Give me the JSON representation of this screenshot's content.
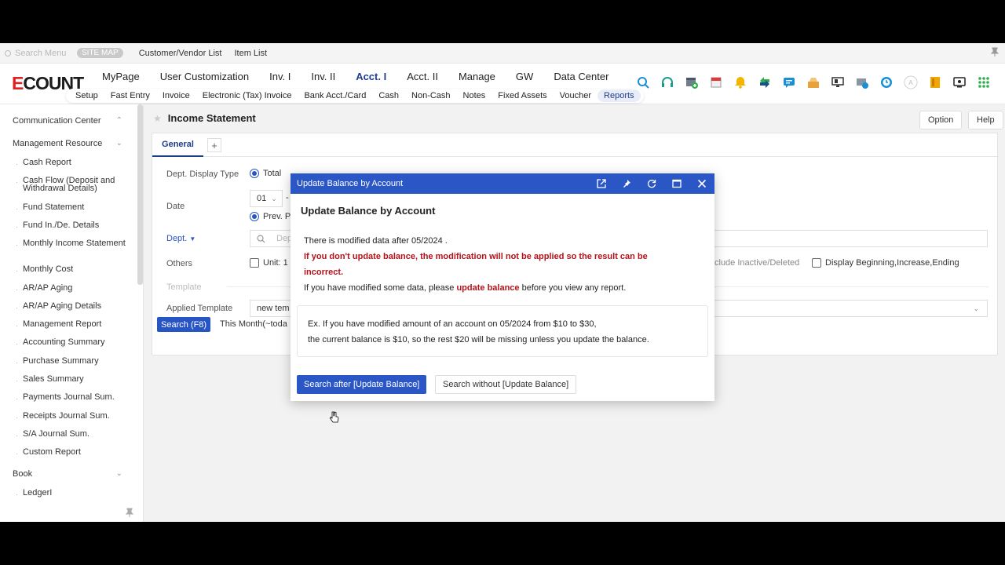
{
  "topbar": {
    "search_placeholder": "Search Menu",
    "sitemap_label": "SITE MAP",
    "links": [
      "Customer/Vendor List",
      "Item List"
    ]
  },
  "header": {
    "logo_text": "ECOUNT",
    "main_nav": [
      "MyPage",
      "User Customization",
      "Inv. I",
      "Inv. II",
      "Acct. I",
      "Acct. II",
      "Manage",
      "GW",
      "Data Center"
    ],
    "main_nav_active": "Acct. I",
    "sub_nav": [
      "Setup",
      "Fast Entry",
      "Invoice",
      "Electronic (Tax) Invoice",
      "Bank Acct./Card",
      "Cash",
      "Non-Cash",
      "Notes",
      "Fixed Assets",
      "Voucher",
      "Reports"
    ],
    "sub_nav_active": "Reports",
    "icons": [
      "search-icon",
      "headset-icon",
      "add-window-icon",
      "calendar-icon",
      "bell-icon",
      "sync-arrows-icon",
      "chat-icon",
      "inbox-icon",
      "display-icon",
      "print-settings-icon",
      "clock-icon",
      "user-avatar-icon",
      "book-icon",
      "monitor-icon",
      "grid-apps-icon"
    ]
  },
  "sidebar": {
    "sections": [
      {
        "label": "Communication Center",
        "chevron": "up"
      },
      {
        "label": "Management Resource",
        "chevron": "down"
      }
    ],
    "items": [
      "Cash Report",
      "Cash Flow (Deposit and Withdrawal Details)",
      "Fund Statement",
      "Fund In./De. Details",
      "Monthly Income Statement",
      "Monthly Cost",
      "AR/AP Aging",
      "AR/AP Aging Details",
      "Management Report",
      "Accounting Summary",
      "Purchase Summary",
      "Sales Summary",
      "Payments Journal Sum.",
      "Receipts Journal Sum.",
      "S/A Journal Sum.",
      "Custom Report"
    ],
    "book_section": "Book",
    "book_items": [
      "LedgerI"
    ]
  },
  "page": {
    "title": "Income Statement",
    "option_label": "Option",
    "help_label": "Help",
    "tab_label": "General",
    "tab_add": "+",
    "form": {
      "dept_display_type_label": "Dept. Display Type",
      "dept_display_total": "Total",
      "date_label": "Date",
      "date_month": "01",
      "date_dash": "-",
      "prev_period": "Prev. P",
      "dept_label": "Dept.",
      "dept_placeholder": "Dep",
      "others_label": "Others",
      "unit_label": "Unit: 1",
      "include_inactive": "clude Inactive/Deleted",
      "display_beginning": "Display Beginning,Increase,Ending",
      "template_label": "Template",
      "applied_template_label": "Applied Template",
      "applied_template_value": "new tem"
    },
    "search_button": "Search (F8)",
    "period_text": "This Month(~toda"
  },
  "dialog": {
    "bar_title": "Update Balance by Account",
    "title": "Update Balance by Account",
    "line1": "There is modified data after 05/2024 .",
    "warning_line1": "If you don't update balance, the modification will not be applied so the result can be",
    "warning_line2": "incorrect.",
    "line3_pre": "If you have modified some data, please ",
    "line3_emph": "update balance",
    "line3_post": " before you view any report.",
    "example_line1": "Ex. If you have modified amount of an account on 05/2024 from $10 to $30,",
    "example_line2": "the current balance is $10, so the rest $20 will be missing unless you update the balance.",
    "primary_button": "Search after [Update Balance]",
    "secondary_button": "Search without [Update Balance]",
    "icons": [
      "external-link-icon",
      "pin-icon",
      "refresh-icon",
      "maximize-icon",
      "close-icon"
    ]
  }
}
